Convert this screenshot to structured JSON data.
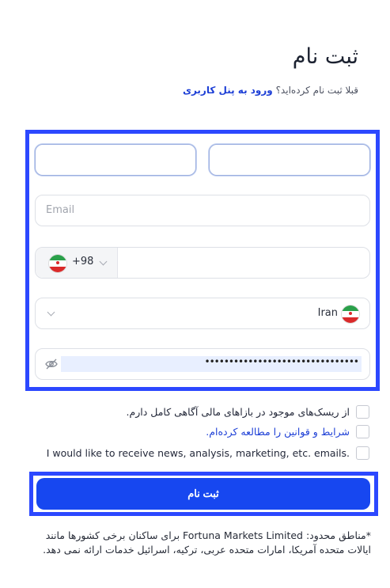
{
  "header": {
    "title": "ثبت نام",
    "subtitle_text": "قبلا ثبت نام کرده‌اید؟",
    "login_link": "ورود به پنل کاربری"
  },
  "form": {
    "first_name": {
      "value": "",
      "placeholder": ""
    },
    "last_name": {
      "value": "",
      "placeholder": ""
    },
    "email": {
      "value": "",
      "placeholder": "Email"
    },
    "phone": {
      "country_code": "+98",
      "flag_icon": "iran-flag-icon",
      "value": ""
    },
    "country": {
      "selected": "Iran",
      "flag_icon": "iran-flag-icon"
    },
    "password": {
      "masked_value": "••••••••••••••••••••••••••••••••",
      "toggle_icon": "eye-off-icon"
    }
  },
  "checkboxes": [
    {
      "label": "از ریسک‌های موجود در بازاهای مالی آگاهی کامل دارم.",
      "checked": false
    },
    {
      "label": "شرایط و قوانین را مطالعه کرده‌ام.",
      "checked": false
    },
    {
      "label": "I would like to receive news, analysis, marketing, etc. emails.",
      "checked": false
    }
  ],
  "submit": {
    "label": "ثبت نام"
  },
  "notice": "*مناطق محدود: Fortuna Markets Limited برای ساکنان برخی کشورها مانند ایالات متحده آمریکا، امارات متحده عربی، ترکیه، اسرائیل خدمات ارائه نمی دهد.",
  "colors": {
    "accent": "#1747f0",
    "highlight_frame": "#2c48ff",
    "link": "#1d3fd6"
  }
}
